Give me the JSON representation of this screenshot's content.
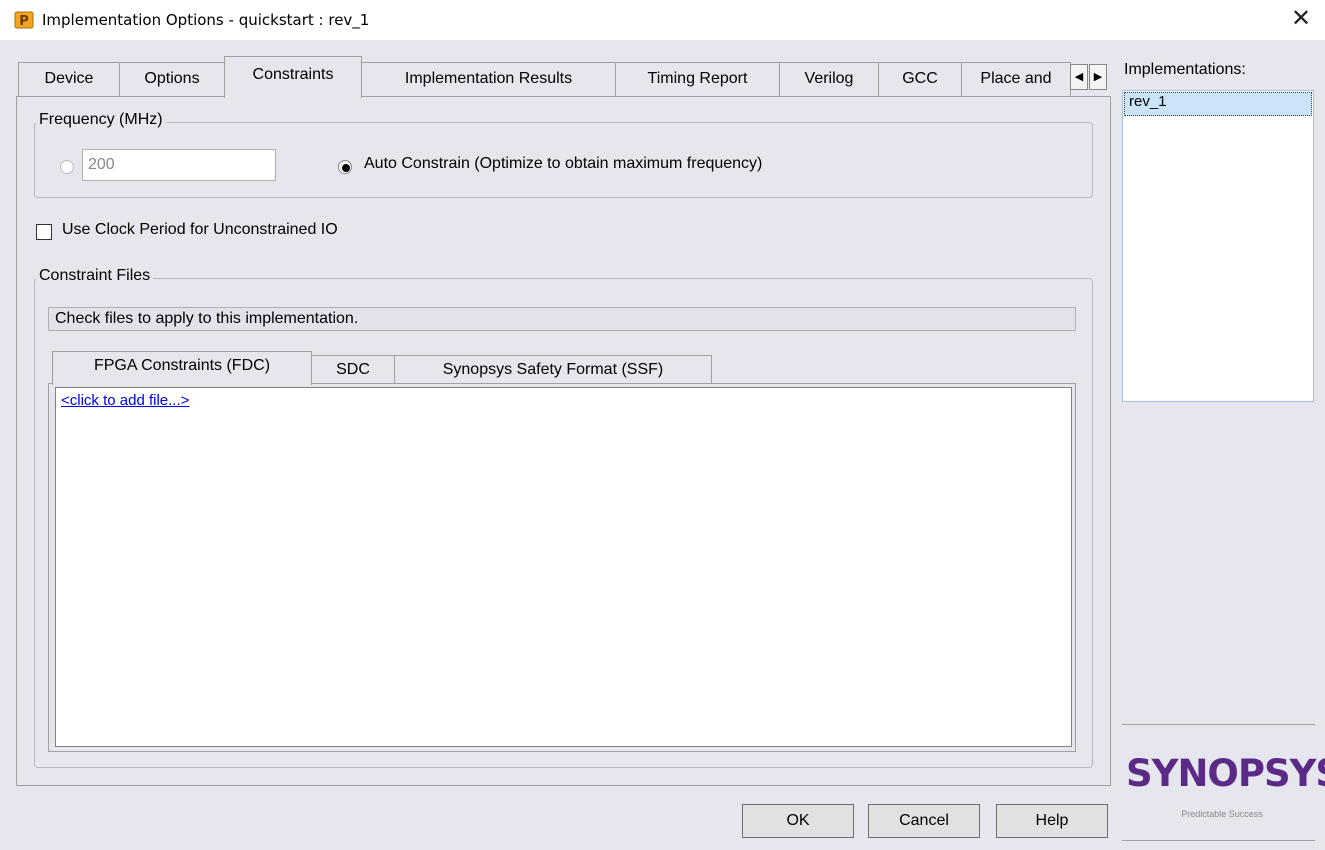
{
  "window": {
    "title": "Implementation Options  -  quickstart : rev_1",
    "close_symbol": "✕"
  },
  "tabs": [
    {
      "label": "Device"
    },
    {
      "label": "Options"
    },
    {
      "label": "Constraints",
      "active": true
    },
    {
      "label": "Implementation Results"
    },
    {
      "label": "Timing Report"
    },
    {
      "label": "Verilog"
    },
    {
      "label": "GCC"
    },
    {
      "label": "Place and"
    }
  ],
  "tab_scroll": {
    "left": "◀",
    "right": "▶"
  },
  "frequency": {
    "group_label": "Frequency (MHz)",
    "value": "200",
    "auto_label": "Auto Constrain (Optimize to obtain maximum frequency)",
    "auto_selected": true
  },
  "clock_period": {
    "label": "Use Clock Period for Unconstrained IO",
    "checked": false
  },
  "constraint_files": {
    "group_label": "Constraint Files",
    "hint": "Check files to apply to this implementation.",
    "subtabs": [
      {
        "label": "FPGA Constraints (FDC)",
        "active": true
      },
      {
        "label": "SDC"
      },
      {
        "label": "Synopsys Safety Format (SSF)"
      }
    ],
    "add_file_link": "<click to add file...>"
  },
  "implementations": {
    "label": "Implementations:",
    "items": [
      "rev_1"
    ]
  },
  "logo": {
    "brand": "SYNOPSYS",
    "tagline": "Predictable Success",
    "color": "#5b2a86"
  },
  "buttons": {
    "ok": "OK",
    "cancel": "Cancel",
    "help": "Help"
  }
}
